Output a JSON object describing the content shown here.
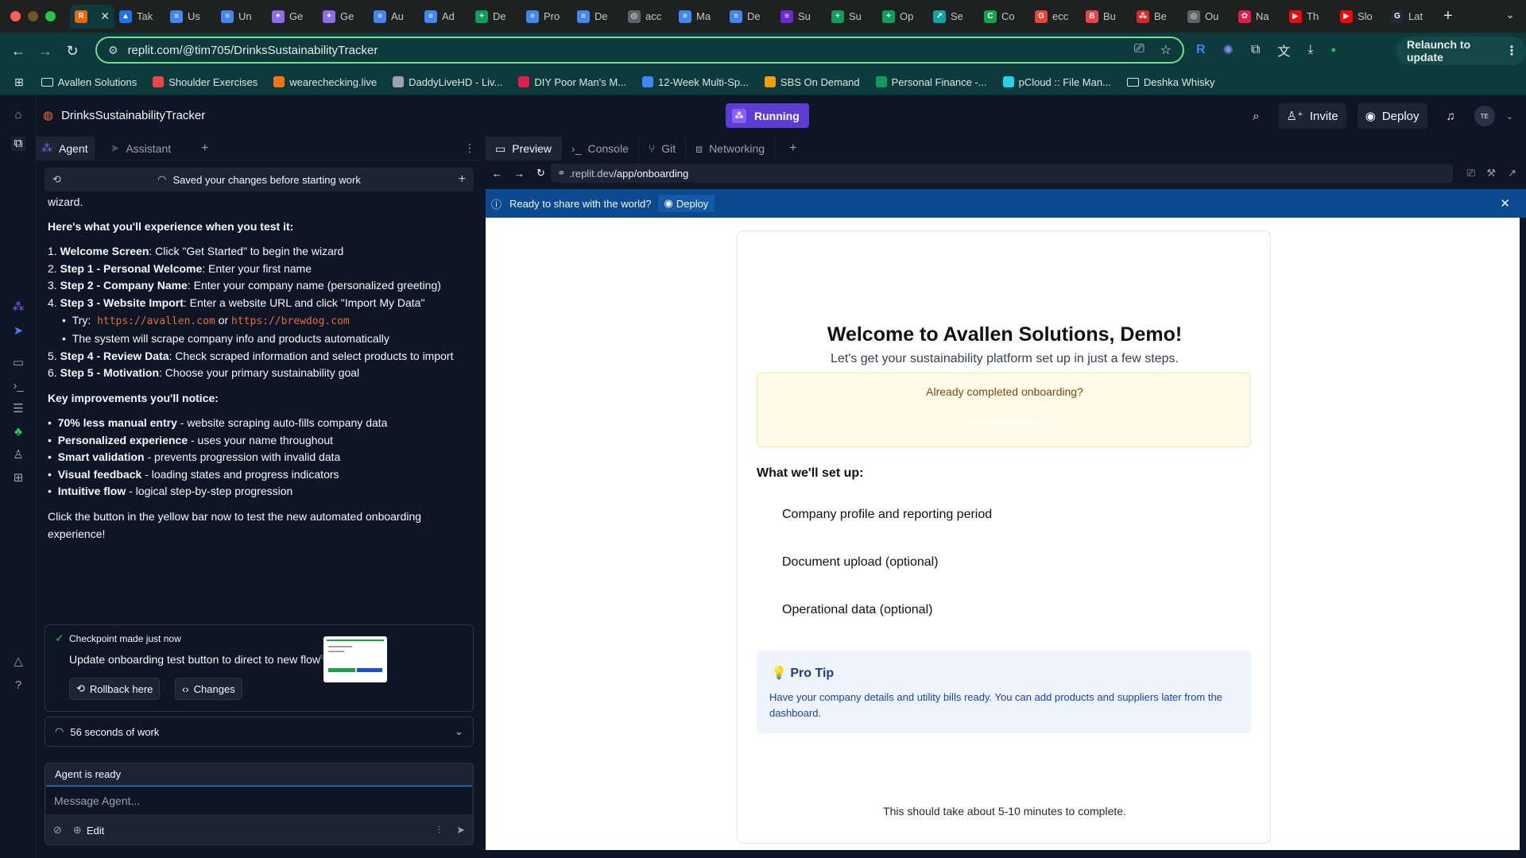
{
  "browser": {
    "tabs": [
      {
        "label": "",
        "color": "#f26207",
        "glyph": "R",
        "active": true
      },
      {
        "label": "Tak",
        "color": "#1a73e8",
        "glyph": "▲"
      },
      {
        "label": "Us",
        "color": "#4285f4",
        "glyph": "≡"
      },
      {
        "label": "Un",
        "color": "#4285f4",
        "glyph": "≡"
      },
      {
        "label": "Ge",
        "color": "#8e6cf1",
        "glyph": "✦"
      },
      {
        "label": "Ge",
        "color": "#8e6cf1",
        "glyph": "✦"
      },
      {
        "label": "Au",
        "color": "#4285f4",
        "glyph": "≡"
      },
      {
        "label": "Ad",
        "color": "#4285f4",
        "glyph": "≡"
      },
      {
        "label": "De",
        "color": "#0f9d58",
        "glyph": "+"
      },
      {
        "label": "Pro",
        "color": "#4285f4",
        "glyph": "≡"
      },
      {
        "label": "De",
        "color": "#4285f4",
        "glyph": "≡"
      },
      {
        "label": "acc",
        "color": "#5f6368",
        "glyph": "◎"
      },
      {
        "label": "Ma",
        "color": "#4285f4",
        "glyph": "≡"
      },
      {
        "label": "De",
        "color": "#4285f4",
        "glyph": "≡"
      },
      {
        "label": "Su",
        "color": "#6d28d9",
        "glyph": "≡"
      },
      {
        "label": "Su",
        "color": "#0f9d58",
        "glyph": "+"
      },
      {
        "label": "Op",
        "color": "#0f9d58",
        "glyph": "+"
      },
      {
        "label": "Se",
        "color": "#0ea5a4",
        "glyph": "↗"
      },
      {
        "label": "Co",
        "color": "#16a34a",
        "glyph": "C"
      },
      {
        "label": "ecc",
        "color": "#ea4335",
        "glyph": "G"
      },
      {
        "label": "Bu",
        "color": "#ef4444",
        "glyph": "B"
      },
      {
        "label": "Be",
        "color": "#dc2626",
        "glyph": "⁂"
      },
      {
        "label": "Ou",
        "color": "#5f6368",
        "glyph": "◎"
      },
      {
        "label": "Na",
        "color": "#e11d48",
        "glyph": "✿"
      },
      {
        "label": "Th",
        "color": "#ff0000",
        "glyph": "▶"
      },
      {
        "label": "Slo",
        "color": "#ff0000",
        "glyph": "▶"
      },
      {
        "label": "Lat",
        "color": "#1f2937",
        "glyph": "G"
      }
    ],
    "url": "replit.com/@tim705/DrinksSustainabilityTracker",
    "relaunch_label": "Relaunch to update",
    "bookmarks": [
      {
        "label": "Avallen Solutions",
        "type": "folder"
      },
      {
        "label": "Shoulder Exercises",
        "color": "#ef4444"
      },
      {
        "label": "wearechecking.live",
        "color": "#f97316"
      },
      {
        "label": "DaddyLiveHD - Liv...",
        "color": "#9ca3af"
      },
      {
        "label": "DIY Poor Man's M...",
        "color": "#e11d48"
      },
      {
        "label": "12-Week Multi-Sp...",
        "color": "#4285f4"
      },
      {
        "label": "SBS On Demand",
        "color": "#f59e0b"
      },
      {
        "label": "Personal Finance -...",
        "color": "#0f9d58"
      },
      {
        "label": "pCloud :: File Man...",
        "color": "#22d3ee"
      },
      {
        "label": "Deshka Whisky",
        "type": "folder"
      }
    ]
  },
  "replit": {
    "project_name": "DrinksSustainabilityTracker",
    "status_label": "Running",
    "invite_label": "Invite",
    "deploy_label": "Deploy",
    "avatar_initials": "TE"
  },
  "agent_panel": {
    "tabs": [
      "Agent",
      "Assistant"
    ],
    "saved_notice": "Saved your changes before starting work",
    "message": {
      "l0": "wizard.",
      "h1": "Here's what you'll experience when you test it:",
      "s1b": "Welcome Screen",
      "s1": ": Click \"Get Started\" to begin the wizard",
      "s2b": "Step 1 - Personal Welcome",
      "s2": ": Enter your first name",
      "s3b": "Step 2 - Company Name",
      "s3": ": Enter your company name (personalized greeting)",
      "s4b": "Step 3 - Website Import",
      "s4": ": Enter a website URL and click \"Import My Data\"",
      "try_label": "Try:",
      "try_url1": "https://avallen.com",
      "try_or": "or",
      "try_url2": "https://brewdog.com",
      "scrape": "The system will scrape company info and products automatically",
      "s5b": "Step 4 - Review Data",
      "s5": ": Check scraped information and select products to import",
      "s6b": "Step 5 - Motivation",
      "s6": ": Choose your primary sustainability goal",
      "h2": "Key improvements you'll notice:",
      "k1b": "70% less manual entry",
      "k1": " - website scraping auto-fills company data",
      "k2b": "Personalized experience",
      "k2": " - uses your name throughout",
      "k3b": "Smart validation",
      "k3": " - prevents progression with invalid data",
      "k4b": "Visual feedback",
      "k4": " - loading states and progress indicators",
      "k5b": "Intuitive flow",
      "k5": " - logical step-by-step progression",
      "closing1": "Click the button in the yellow bar now to test the new automated onboarding",
      "closing2": "experience!"
    },
    "checkpoint": {
      "status": "Checkpoint made just now",
      "title": "Update onboarding test button to direct to new flow",
      "rollback_label": "Rollback here",
      "changes_label": "Changes"
    },
    "work_summary": "56 seconds of work",
    "composer": {
      "status": "Agent is ready",
      "placeholder": "Message Agent...",
      "edit_label": "Edit"
    }
  },
  "preview_panel": {
    "tabs": [
      "Preview",
      "Console",
      "Git",
      "Networking"
    ],
    "url_prefix": ".replit.dev",
    "url_path": "/app/onboarding",
    "banner_text": "Ready to share with the world?",
    "banner_button": "Deploy",
    "page": {
      "title": "Welcome to Avallen Solutions, Demo!",
      "subtitle": "Let's get your sustainability platform set up in just a few steps.",
      "completed_prompt": "Already completed onboarding?",
      "dashboard_button": "Go to Dashboard",
      "setup_heading": "What we'll set up:",
      "setup_items": [
        "Company profile and reporting period",
        "Document upload (optional)",
        "Operational data (optional)"
      ],
      "tip_heading": "Pro Tip",
      "tip_body": "Have your company details and utility bills ready. You can add products and suppliers later from the dashboard.",
      "footnote": "This should take about 5-10 minutes to complete."
    }
  }
}
